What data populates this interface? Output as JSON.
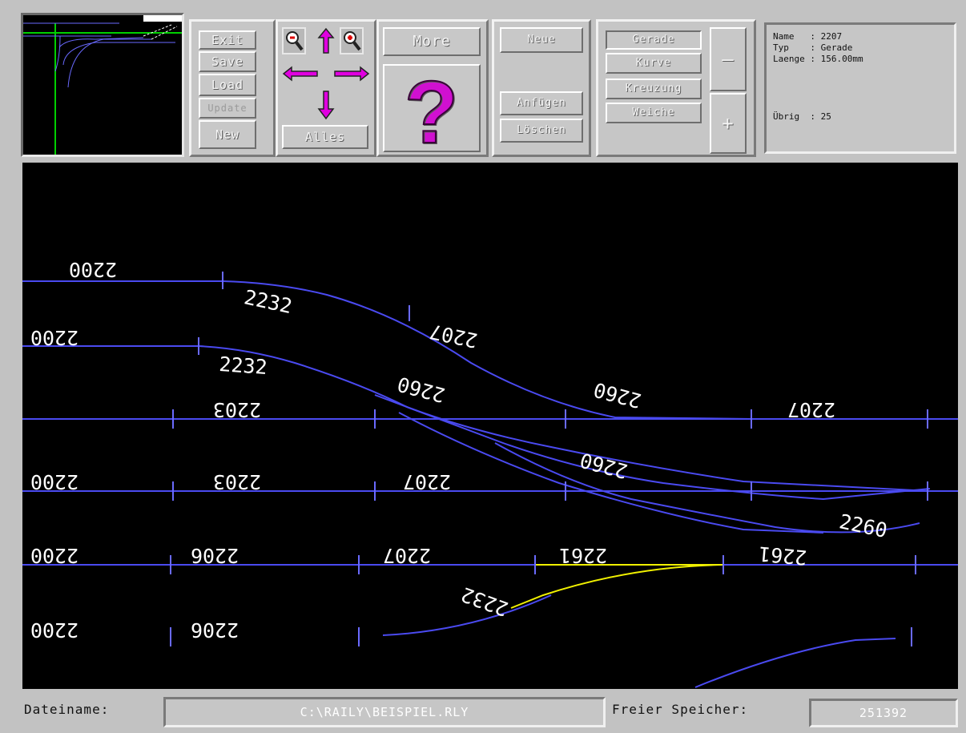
{
  "file_buttons": [
    {
      "label": "Exit",
      "state": "normal"
    },
    {
      "label": "Save",
      "state": "normal"
    },
    {
      "label": "Load",
      "state": "normal"
    },
    {
      "label": "Update",
      "state": "disabled"
    },
    {
      "label": "New",
      "state": "normal"
    }
  ],
  "nav": {
    "zoom_out_icon": "magnifier-minus",
    "up_icon": "arrow-up",
    "zoom_in_icon": "magnifier-plus",
    "left_icon": "arrow-left",
    "right_icon": "arrow-right",
    "down_icon": "arrow-down",
    "all_label": "Alles"
  },
  "more_label": "More",
  "help_icon": "question-mark",
  "edit_buttons": {
    "neue": "Neue",
    "anfuegen": "Anfügen",
    "loeschen": "Löschen"
  },
  "type_buttons": [
    {
      "label": "Gerade",
      "active": true
    },
    {
      "label": "Kurve",
      "active": false
    },
    {
      "label": "Kreuzung",
      "active": false
    },
    {
      "label": "Weiche",
      "active": false
    }
  ],
  "minus_label": "—",
  "plus_label": "+",
  "info": {
    "name_line": "Name   : 2207",
    "typ_line": "Typ    : Gerade",
    "laenge_line": "Laenge : 156.00mm",
    "uebrig_line": "Übrig  : 25"
  },
  "status": {
    "dateiname_label": "Dateiname:",
    "dateiname_value": "C:\\RAILY\\BEISPIEL.RLY",
    "speicher_label": "Freier Speicher:",
    "speicher_value": "251392"
  },
  "track_labels": [
    "2200",
    "2200",
    "2232",
    "2207",
    "2232",
    "2203",
    "2260",
    "2260",
    "2207",
    "2200",
    "2203",
    "2207",
    "2260",
    "2200",
    "2206",
    "2207",
    "2261",
    "2261",
    "2260",
    "2232",
    "2200",
    "2206"
  ],
  "colors": {
    "panel": "#c2c2c2",
    "track": "#4a4af0",
    "selected_track": "#f0f000",
    "overview_green": "#00d000",
    "arrow_magenta": "#e000e0",
    "help_magenta": "#d010d0"
  }
}
